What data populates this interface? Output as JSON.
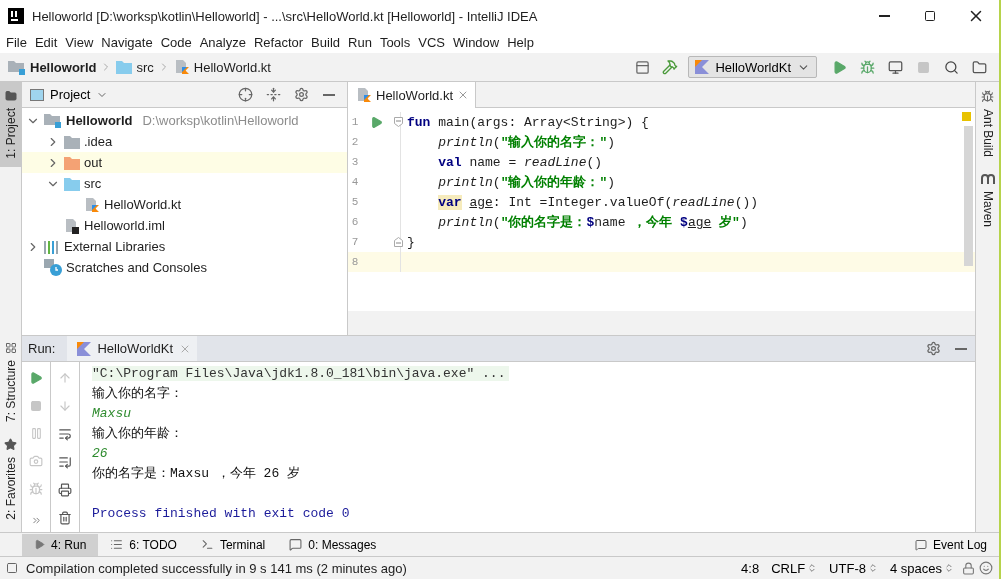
{
  "window": {
    "title": "Helloworld [D:\\worksp\\kotlin\\Helloworld] - ...\\src\\HelloWorld.kt [Helloworld] - IntelliJ IDEA"
  },
  "menu": [
    "File",
    "Edit",
    "View",
    "Navigate",
    "Code",
    "Analyze",
    "Refactor",
    "Build",
    "Run",
    "Tools",
    "VCS",
    "Window",
    "Help"
  ],
  "breadcrumbs": [
    {
      "label": "Helloworld",
      "kind": "module"
    },
    {
      "label": "src",
      "kind": "folder"
    },
    {
      "label": "HelloWorld.kt",
      "kind": "kotlin"
    }
  ],
  "run_config": {
    "label": "HelloWorldKt"
  },
  "left_stripe": [
    {
      "label": "1: Project",
      "selected": true
    }
  ],
  "left_stripe_bottom": [
    {
      "label": "7: Structure",
      "selected": false,
      "kind": "structure"
    },
    {
      "label": "2: Favorites",
      "selected": false,
      "kind": "favorites"
    }
  ],
  "right_stripe": [
    {
      "label": "Ant Build",
      "kind": "ant"
    },
    {
      "label": "Maven",
      "kind": "maven"
    }
  ],
  "project_panel": {
    "title": "Project",
    "tree": [
      {
        "label": "Helloworld",
        "path": "D:\\worksp\\kotlin\\Helloworld",
        "kind": "module",
        "expanded": true,
        "selected": false,
        "children": [
          {
            "label": ".idea",
            "kind": "folder",
            "expanded": false,
            "selected": false
          },
          {
            "label": "out",
            "kind": "folder_excluded",
            "expanded": false,
            "selected": true
          },
          {
            "label": "src",
            "kind": "folder_source",
            "expanded": true,
            "selected": false,
            "children": [
              {
                "label": "HelloWorld.kt",
                "kind": "kotlin_file",
                "selected": false
              }
            ]
          },
          {
            "label": "Helloworld.iml",
            "kind": "iml_file",
            "selected": false
          }
        ]
      },
      {
        "label": "External Libraries",
        "kind": "libraries",
        "expanded": false,
        "selected": false
      },
      {
        "label": "Scratches and Consoles",
        "kind": "scratches",
        "selected": false
      }
    ]
  },
  "editor": {
    "tabs": [
      {
        "label": "HelloWorld.kt",
        "selected": true
      }
    ],
    "lines": [
      {
        "number": "1",
        "kind": "fold_start",
        "current": false,
        "runnable": true,
        "indented": false,
        "tokens": [
          {
            "kind": "keyword",
            "text": "fun"
          },
          {
            "kind": "plain",
            "text": " main(args: Array<String>) {"
          }
        ]
      },
      {
        "number": "2",
        "kind": "code",
        "current": false,
        "runnable": false,
        "indented": true,
        "tokens": [
          {
            "kind": "call",
            "text": "println"
          },
          {
            "kind": "plain",
            "text": "("
          },
          {
            "kind": "string",
            "text": "\"输入你的名字：\""
          },
          {
            "kind": "plain",
            "text": ")"
          }
        ]
      },
      {
        "number": "3",
        "kind": "code",
        "current": false,
        "runnable": false,
        "indented": true,
        "tokens": [
          {
            "kind": "keyword",
            "text": "val"
          },
          {
            "kind": "plain",
            "text": " name = "
          },
          {
            "kind": "call",
            "text": "readLine"
          },
          {
            "kind": "plain",
            "text": "()"
          }
        ]
      },
      {
        "number": "4",
        "kind": "code",
        "current": false,
        "runnable": false,
        "indented": true,
        "tokens": [
          {
            "kind": "call",
            "text": "println"
          },
          {
            "kind": "plain",
            "text": "("
          },
          {
            "kind": "string",
            "text": "\"输入你的年龄：\""
          },
          {
            "kind": "plain",
            "text": ")"
          }
        ]
      },
      {
        "number": "5",
        "kind": "code",
        "current": false,
        "runnable": false,
        "indented": true,
        "tokens": [
          {
            "kind": "keyword_marked",
            "text": "var"
          },
          {
            "kind": "variable_spaced",
            "text": "age"
          },
          {
            "kind": "plain",
            "text": ": Int =Integer.valueOf("
          },
          {
            "kind": "call",
            "text": "readLine"
          },
          {
            "kind": "plain",
            "text": "())"
          }
        ]
      },
      {
        "number": "6",
        "kind": "code",
        "current": false,
        "runnable": false,
        "indented": true,
        "tokens": [
          {
            "kind": "call",
            "text": "println"
          },
          {
            "kind": "plain",
            "text": "("
          },
          {
            "kind": "string",
            "text": "\"你的名字是："
          },
          {
            "kind": "template",
            "text": "$"
          },
          {
            "kind": "plain",
            "text": "name "
          },
          {
            "kind": "string",
            "text": "，今年 "
          },
          {
            "kind": "template",
            "text": "$"
          },
          {
            "kind": "variable",
            "text": "age"
          },
          {
            "kind": "string",
            "text": " 岁\""
          },
          {
            "kind": "plain",
            "text": ")"
          }
        ]
      },
      {
        "number": "7",
        "kind": "fold_end",
        "current": false,
        "runnable": false,
        "indented": false,
        "tokens": [
          {
            "kind": "plain",
            "text": "}"
          }
        ]
      },
      {
        "number": "8",
        "kind": "code",
        "current": true,
        "runnable": false
      }
    ]
  },
  "run_panel": {
    "label": "Run:",
    "tabs": [
      {
        "label": "HelloWorldKt",
        "selected": true
      }
    ],
    "console": [
      {
        "kind": "command",
        "text": "\"C:\\Program Files\\Java\\jdk1.8.0_181\\bin\\java.exe\" ..."
      },
      {
        "kind": "output",
        "text": "输入你的名字："
      },
      {
        "kind": "input",
        "text": "Maxsu"
      },
      {
        "kind": "output",
        "text": "输入你的年龄："
      },
      {
        "kind": "input",
        "text": "26"
      },
      {
        "kind": "output",
        "text": "你的名字是：Maxsu ，今年 26 岁"
      },
      {
        "kind": "system",
        "text": "Process finished with exit code 0"
      }
    ]
  },
  "tool_windows": [
    {
      "label": "4: Run",
      "selected": true,
      "kind": "run"
    },
    {
      "label": "6: TODO",
      "selected": false,
      "kind": "todo"
    },
    {
      "label": "Terminal",
      "selected": false,
      "kind": "terminal"
    },
    {
      "label": "0: Messages",
      "selected": false,
      "kind": "messages"
    }
  ],
  "event_log": {
    "label": "Event Log"
  },
  "status_bar": {
    "message": "Compilation completed successfully in 9 s 141 ms (2 minutes ago)",
    "position": "4:8",
    "line_separator": "CRLF",
    "encoding": "UTF-8",
    "indent": "4 spaces"
  }
}
